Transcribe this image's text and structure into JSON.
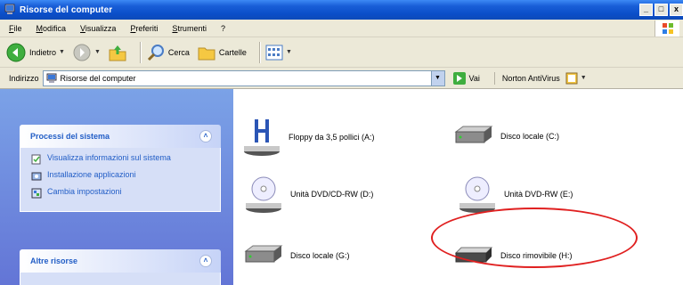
{
  "window": {
    "title": "Risorse del computer",
    "buttons": [
      "_",
      "□",
      "x"
    ]
  },
  "menu": [
    "File",
    "Modifica",
    "Visualizza",
    "Preferiti",
    "Strumenti",
    "?"
  ],
  "toolbar": {
    "back": "Indietro",
    "search": "Cerca",
    "folders": "Cartelle"
  },
  "address": {
    "label": "Indirizzo",
    "value": "Risorse del computer",
    "go": "Vai",
    "norton": "Norton AntiVirus"
  },
  "taskpane": {
    "system": {
      "title": "Processi del sistema",
      "tasks": [
        "Visualizza informazioni sul sistema",
        "Installazione applicazioni",
        "Cambia impostazioni"
      ]
    },
    "other": {
      "title": "Altre risorse"
    }
  },
  "drives": [
    {
      "label": "Floppy da 3,5 pollici (A:)",
      "icon": "floppy-drive-icon"
    },
    {
      "label": "Disco locale (C:)",
      "icon": "hard-disk-icon"
    },
    {
      "label": "Unità DVD/CD-RW (D:)",
      "icon": "optical-drive-icon"
    },
    {
      "label": "Unità DVD-RW (E:)",
      "icon": "optical-drive-icon"
    },
    {
      "label": "Disco locale (G:)",
      "icon": "hard-disk-icon"
    },
    {
      "label": "Disco rimovibile (H:)",
      "icon": "removable-disk-icon"
    }
  ],
  "colors": {
    "titlebar": "#0a4ec9",
    "taskpane": "#6375d6",
    "link": "#215dc6",
    "highlight": "#e02020"
  }
}
